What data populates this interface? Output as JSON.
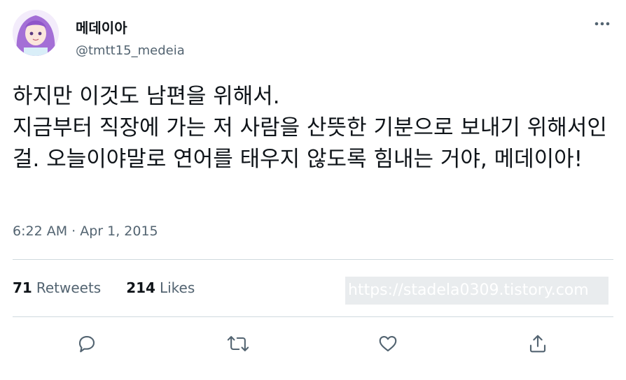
{
  "user": {
    "display_name": "메데이아",
    "handle": "@tmtt15_medeia"
  },
  "tweet": {
    "text": "하지만 이것도 남편을 위해서.\n지금부터 직장에 가는 저 사람을 산뜻한 기분으로 보내기 위해서인걸. 오늘이야말로 연어를 태우지 않도록 힘내는 거야, 메데이아!",
    "timestamp": "6:22 AM · Apr 1, 2015"
  },
  "stats": {
    "retweets_count": "71",
    "retweets_label": "Retweets",
    "likes_count": "214",
    "likes_label": "Likes"
  },
  "watermark": "https://stadela0309.tistory.com",
  "icons": {
    "more": "more-options-icon",
    "reply": "reply-icon",
    "retweet": "retweet-icon",
    "like": "like-icon",
    "share": "share-icon"
  },
  "colors": {
    "text_primary": "#0f1419",
    "text_secondary": "#536471",
    "divider": "#cfd9de",
    "avatar_hair": "#a46fd6"
  }
}
